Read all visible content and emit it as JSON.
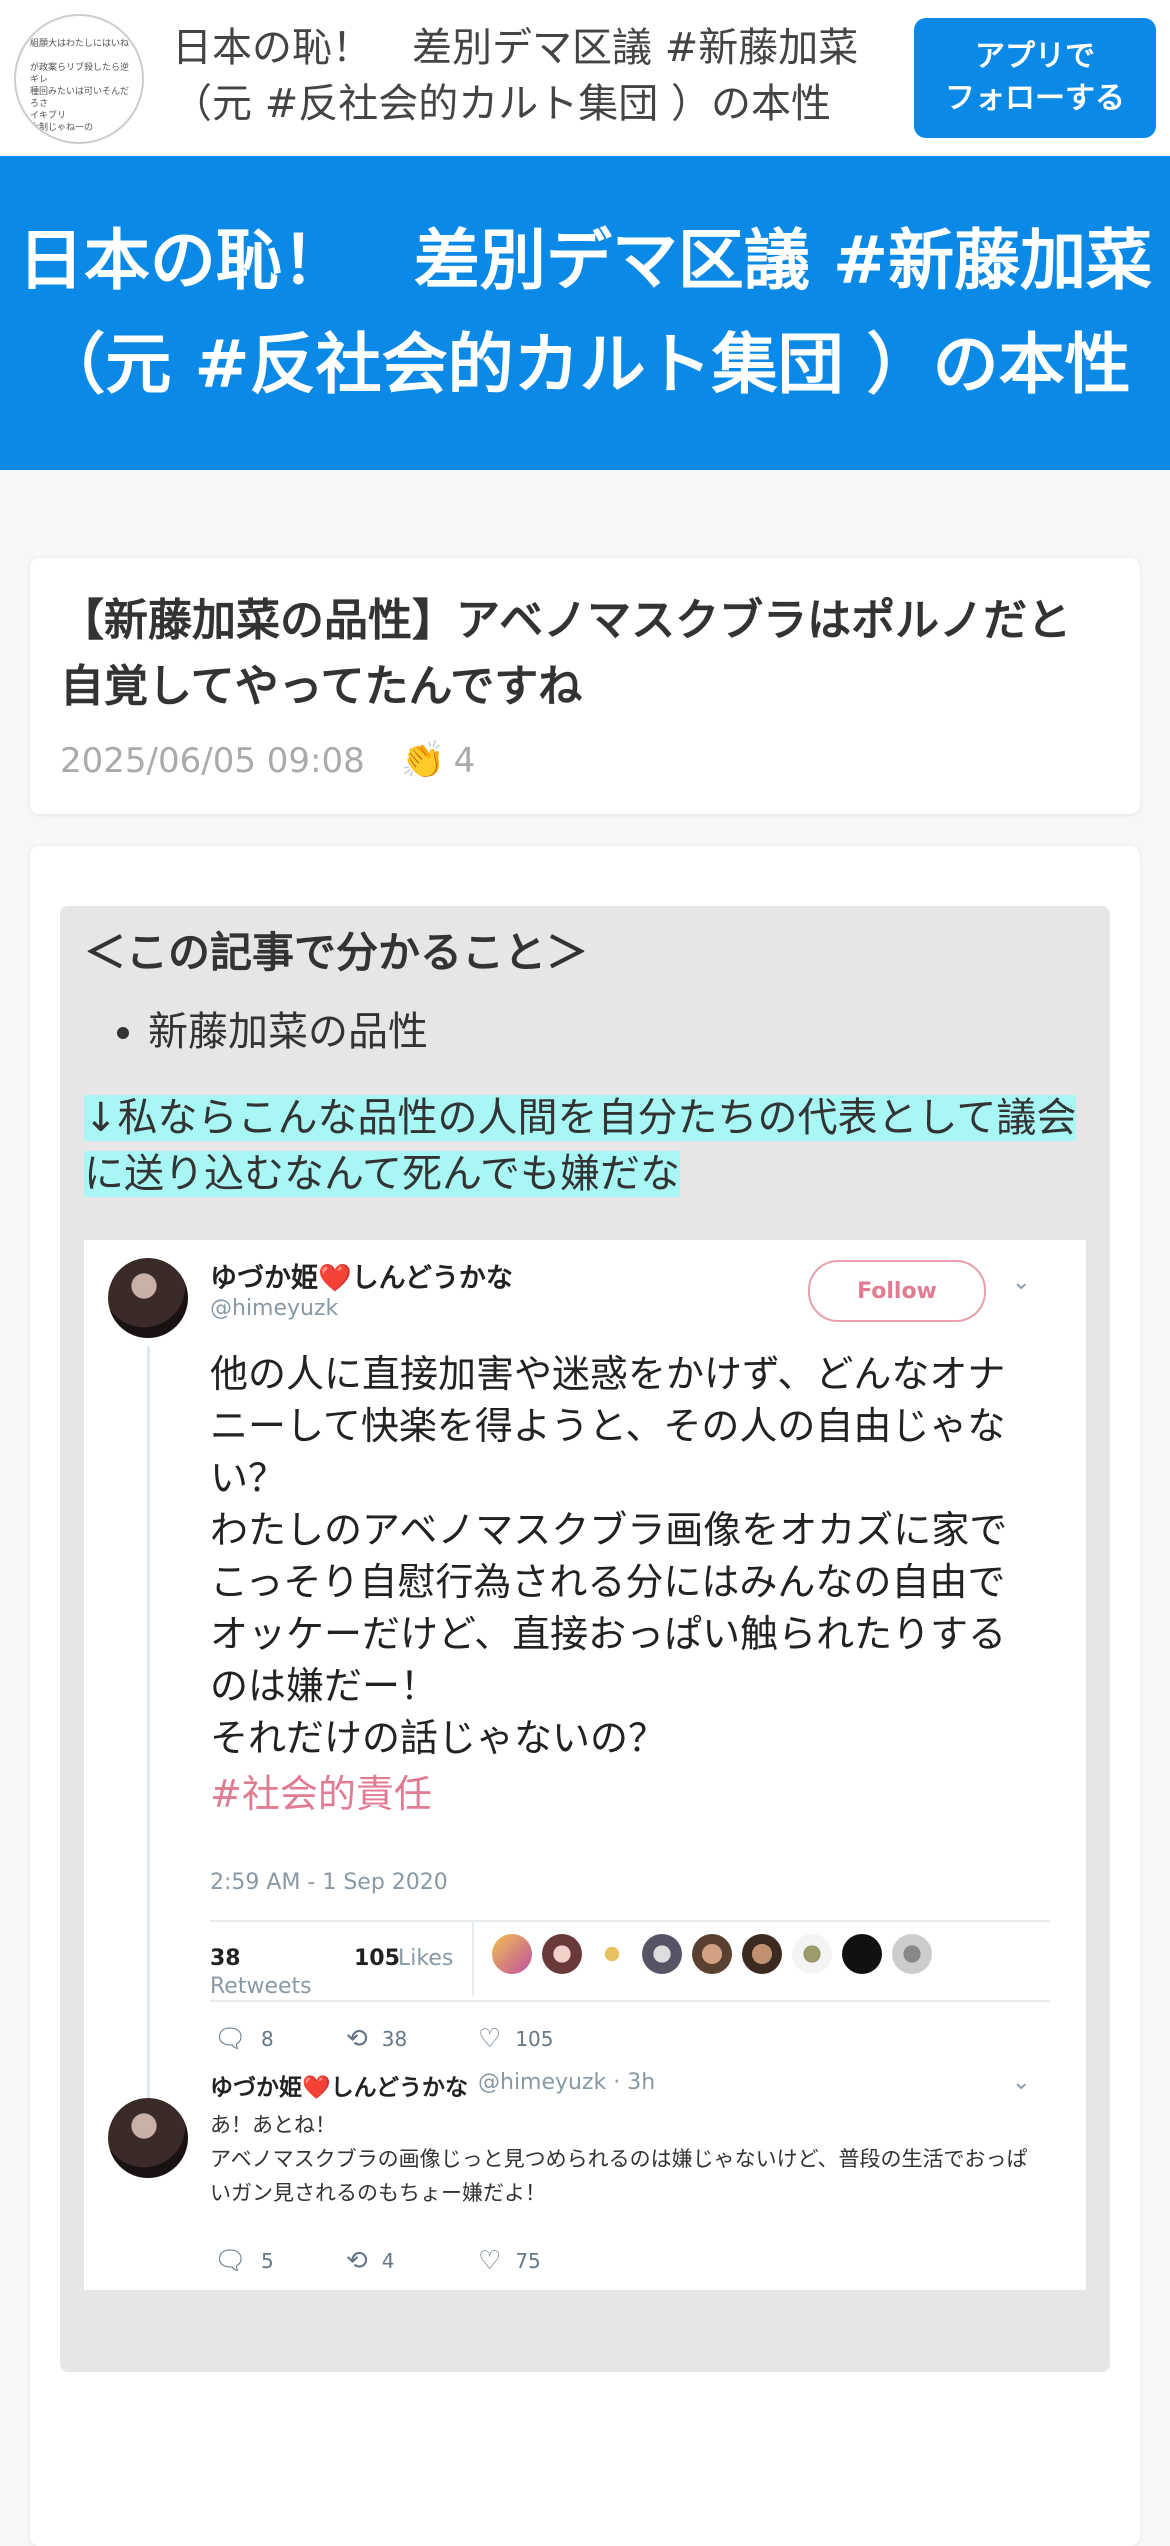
{
  "topbar": {
    "blog_avatar_text": "組願大はわたしにはいね\n\nが政案らリブ殺したら逆ギレ\n種回みたいは可いそんだろさ\nイキブリ\n大制じゃねーの",
    "title": "日本の恥！　差別デマ区議 #新藤加菜（元 #反社会的カルト集団 ）の本性",
    "follow_button": "アプリで\nフォローする"
  },
  "banner": {
    "title": "日本の恥！　差別デマ区議 #新藤加菜（元 #反社会的カルト集団 ）の本性"
  },
  "entry": {
    "title": "【新藤加菜の品性】アベノマスクブラはポルノだと自覚してやってたんですね",
    "date": "2025/06/05 09:08",
    "clap_icon": "clap-icon",
    "clap_count": "4"
  },
  "body": {
    "toc_heading": "＜この記事で分かること＞",
    "toc_items": [
      "新藤加菜の品性"
    ],
    "highlight": "↓私ならこんな品性の人間を自分たちの代表として議会に送り込むなんて死んでも嫌だな"
  },
  "tweet": {
    "name_before_heart": "ゆづか姫",
    "heart": "❤️",
    "name_after_heart": "しんどうかな",
    "handle": "@himeyuzk",
    "follow_label": "Follow",
    "chevron": "⌄",
    "text": "他の人に直接加害や迷惑をかけず、どんなオナニーして快楽を得ようと、その人の自由じゃない？\nわたしのアベノマスクブラ画像をオカズに家でこっそり自慰行為される分にはみんなの自由でオッケーだけど、直接おっぱい触られたりするのは嫌だー！\nそれだけの話じゃないの？",
    "hashtag": "#社会的責任",
    "time": "2:59 AM - 1 Sep 2020",
    "retweets_num": "38",
    "retweets_label": "Retweets",
    "likes_num": "105",
    "likes_label": "Likes",
    "replies": "8",
    "retweet_action": "38",
    "like_action": "105"
  },
  "reply": {
    "name_before_heart": "ゆづか姫",
    "heart": "❤️",
    "name_after_heart": "しんどうかな",
    "handle_time": "@himeyuzk · 3h",
    "text": "あ！あとね！\nアベノマスクブラの画像じっと見つめられるのは嫌じゃないけど、普段の生活でおっぱいガン見されるのもちょー嫌だよ！",
    "replies": "5",
    "retweets": "4",
    "likes": "75"
  },
  "colors": {
    "accent": "#0a8ae6",
    "highlight": "#a8f7f5",
    "hashtag": "#e07b91",
    "box_bg": "#e6e6e6"
  }
}
